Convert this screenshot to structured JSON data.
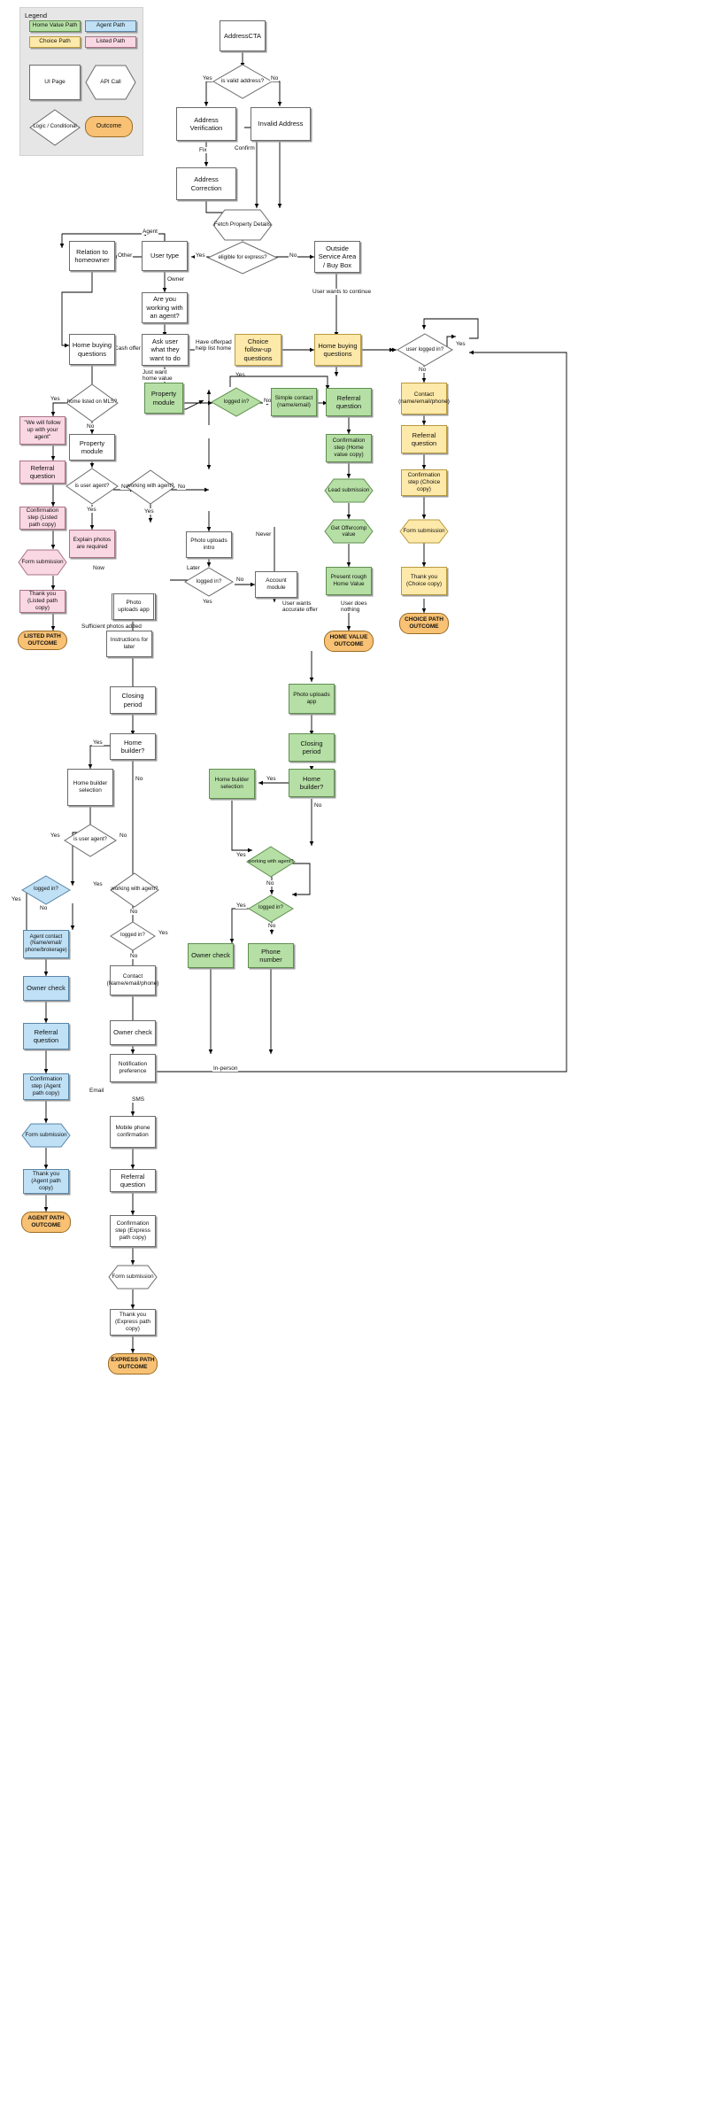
{
  "legend": {
    "title": "Legend",
    "swatches": [
      {
        "label": "Home Value Path",
        "color": "#b5dfa4"
      },
      {
        "label": "Agent Path",
        "color": "#bfe0f5"
      },
      {
        "label": "Choice Path",
        "color": "#fde9a9"
      },
      {
        "label": "Listed Path",
        "color": "#f9d7e3"
      }
    ],
    "shapes": [
      {
        "label": "UI Page",
        "shape": "rect"
      },
      {
        "label": "API Call",
        "shape": "hexagon"
      },
      {
        "label": "Logic / Conditional",
        "shape": "diamond"
      },
      {
        "label": "Outcome",
        "shape": "pill"
      }
    ]
  },
  "nodes": {
    "address_cta": "AddressCTA",
    "is_valid_address": "is valid address?",
    "address_verification": "Address Verification",
    "invalid_address": "Invalid Address",
    "address_correction": "Address Correction",
    "fetch_property_details": "Fetch Property Details",
    "eligible_for_express": "eligible for express?",
    "user_type": "User type",
    "relation_to_homeowner": "Relation to homeowner",
    "outside_service_area": "Outside Service Area / Buy Box",
    "are_you_working_with_agent": "Are you working with an agent?",
    "ask_user_what": "Ask user what they want to do",
    "home_buying_questions_left": "Home buying questions",
    "choice_followup_questions": "Choice follow-up questions",
    "home_buying_questions_right": "Home buying questions",
    "user_logged_in_right": "user logged in?",
    "property_module_1": "Property module",
    "logged_in_1": "logged in?",
    "simple_contact": "Simple contact (name/email)",
    "referral_question_green": "Referral question",
    "contact_name_email_phone_y": "Contact (name/email/phone)",
    "home_listed_on_mls": "home listed on MLS?",
    "we_will_follow_up": "\"We will follow up with your agent\"",
    "property_module_2": "Property module",
    "confirmation_home_value": "Confirmation step (Home value copy)",
    "referral_question_choice": "Referral question",
    "referral_question_pink": "Referral question",
    "is_user_agent_1": "is user agent?",
    "working_with_agent_1": "working with agent?",
    "lead_submission": "Lead submission",
    "confirmation_choice": "Confirmation step (Choice copy)",
    "confirmation_listed": "Confirmation step (Listed path copy)",
    "explain_photos": "Explain photos are required",
    "photo_uploads_intro": "Photo uploads intro",
    "get_offercomp_value": "Get Offercomp value",
    "form_submission_choice": "Form submission",
    "form_submission_listed": "Form submission",
    "logged_in_2": "logged in?",
    "account_module": "Account module",
    "present_rough_home_value": "Present rough Home Value",
    "thank_you_choice": "Thank you (Choice copy)",
    "thank_you_listed": "Thank you (Listed path copy)",
    "photo_uploads_app_1": "Photo uploads app",
    "instructions_for_later": "Instructions for later",
    "home_value_outcome": "HOME VALUE OUTCOME",
    "choice_path_outcome": "CHOICE PATH OUTCOME",
    "listed_path_outcome": "LISTED PATH OUTCOME",
    "closing_period_1": "Closing period",
    "photo_uploads_app_2": "Photo uploads app",
    "home_builder_q_1": "Home builder?",
    "closing_period_2": "Closing period",
    "home_builder_selection_1": "Home builder selection",
    "home_builder_selection_2": "Home builder selection",
    "home_builder_q_2": "Home builder?",
    "is_user_agent_2": "is user agent?",
    "working_with_agent_2": "working with agent?",
    "logged_in_blue": "logged in?",
    "working_with_agent_3": "working with agent?",
    "logged_in_green_2": "logged in?",
    "agent_contact": "Agent contact (Name/email/ phone/brokerage)",
    "logged_in_3": "logged in?",
    "owner_check_green": "Owner check",
    "phone_number": "Phone number",
    "owner_check_blue": "Owner check",
    "contact_name_email_phone_b": "Contact (Name/email/phone)",
    "referral_question_blue": "Referral question",
    "owner_check_white": "Owner check",
    "confirmation_agent": "Confirmation step (Agent path copy)",
    "notification_preference": "Notification preference",
    "form_submission_agent": "Form submission",
    "mobile_phone_confirmation": "Mobile phone confirmation",
    "thank_you_agent": "Thank you (Agent path copy)",
    "referral_question_express": "Referral question",
    "agent_path_outcome": "AGENT PATH OUTCOME",
    "confirmation_express": "Confirmation step (Express path copy)",
    "form_submission_express": "Form submission",
    "thank_you_express": "Thank you (Express path copy)",
    "express_path_outcome": "EXPRESS PATH OUTCOME"
  },
  "edge_labels": {
    "yes": "Yes",
    "no": "No",
    "fix": "Fix",
    "confirm": "Confirm",
    "agent": "Agent",
    "other": "Other",
    "owner": "Owner",
    "cash_offer": "Cash offer",
    "have_offerpad": "Have offerpad help list home",
    "just_want_home_value": "Just want home value",
    "user_wants_continue": "User wants to continue",
    "never": "Never",
    "now": "Now",
    "later": "Later",
    "sufficient_photos": "Sufficient photos added",
    "user_wants_accurate": "User wants accurate offer",
    "user_does_nothing": "User does nothing",
    "in_person": "In-person",
    "email": "Email",
    "sms": "SMS"
  },
  "colors": {
    "home_value": "#b5dfa4",
    "agent": "#bfe0f5",
    "choice": "#fde9a9",
    "listed": "#f9d7e3",
    "outcome": "#f8c173",
    "stroke": "#6b6b6b",
    "legend_bg": "#e6e6e6"
  }
}
